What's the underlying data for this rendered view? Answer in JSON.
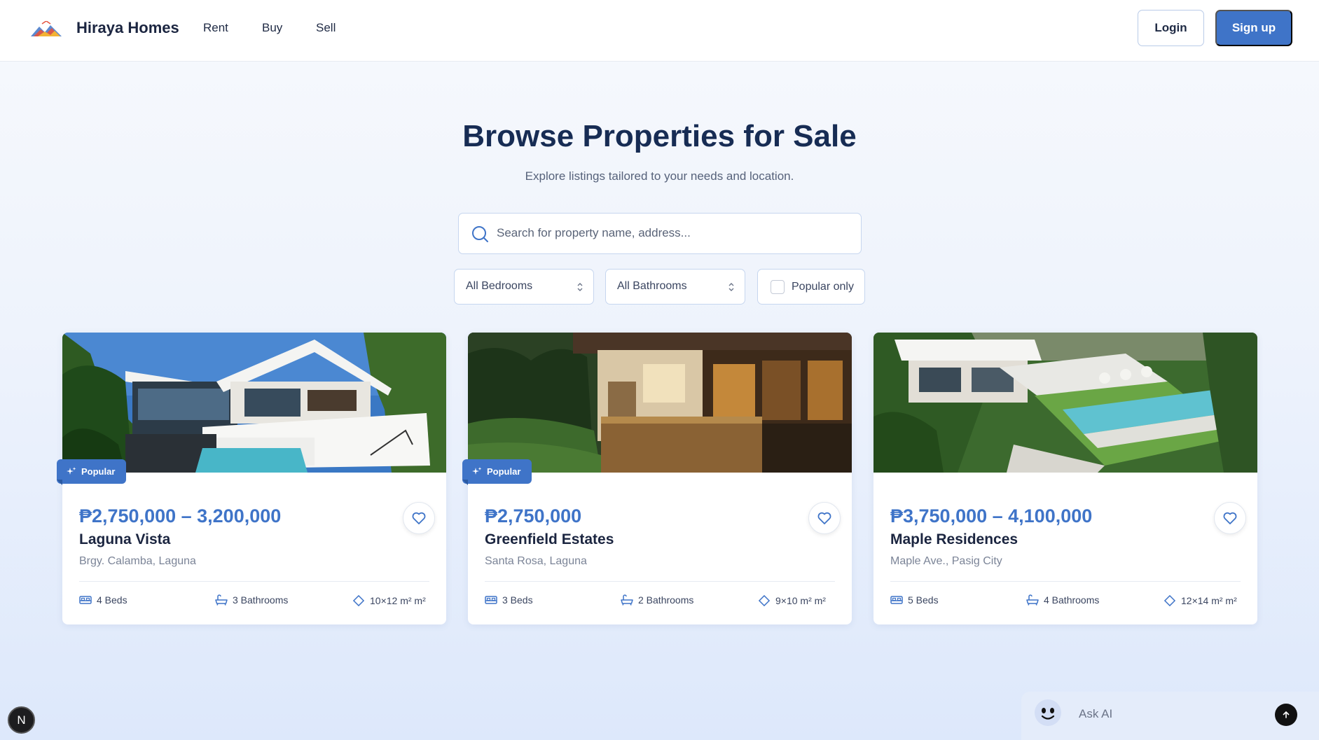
{
  "header": {
    "brand": "Hiraya Homes",
    "nav": [
      "Rent",
      "Buy",
      "Sell"
    ],
    "login_label": "Login",
    "signup_label": "Sign up"
  },
  "hero": {
    "title": "Browse Properties for Sale",
    "subtitle": "Explore listings tailored to your needs and location."
  },
  "search": {
    "placeholder": "Search for property name, address...",
    "value": ""
  },
  "filters": {
    "bedrooms": "All Bedrooms",
    "bathrooms": "All Bathrooms",
    "popular_label": "Popular only",
    "popular_checked": false
  },
  "listings": [
    {
      "popular": true,
      "badge_label": "Popular",
      "price": "₱2,750,000 – 3,200,000",
      "name": "Laguna Vista",
      "location": "Brgy. Calamba, Laguna",
      "beds": "4 Beds",
      "baths": "3 Bathrooms",
      "area": "10×12 m² m²"
    },
    {
      "popular": true,
      "badge_label": "Popular",
      "price": "₱2,750,000",
      "name": "Greenfield Estates",
      "location": "Santa Rosa, Laguna",
      "beds": "3 Beds",
      "baths": "2 Bathrooms",
      "area": "9×10 m² m²"
    },
    {
      "popular": false,
      "price": "₱3,750,000 – 4,100,000",
      "name": "Maple Residences",
      "location": "Maple Ave., Pasig City",
      "beds": "5 Beds",
      "baths": "4 Bathrooms",
      "area": "12×14 m² m²"
    }
  ],
  "assistant": {
    "label": "Ask AI"
  },
  "dev_badge": "N",
  "colors": {
    "accent": "#3f74c8",
    "heading": "#172c54"
  },
  "icons": [
    "logo-icon",
    "search-icon",
    "chevron-updown-icon",
    "sparkle-icon",
    "heart-icon",
    "bed-icon",
    "bath-icon",
    "area-icon",
    "ai-face-icon",
    "arrow-up-icon"
  ]
}
